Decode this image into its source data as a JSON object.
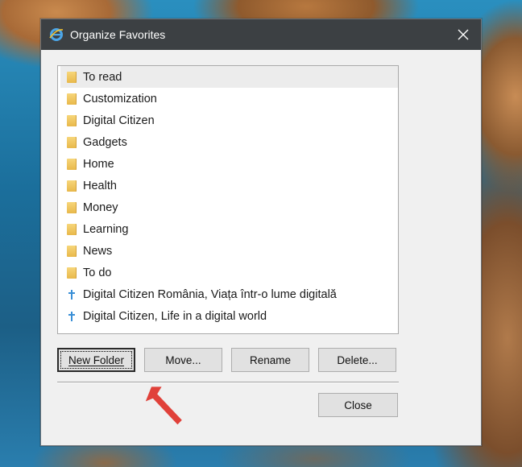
{
  "window": {
    "title": "Organize Favorites",
    "icon": "ie-icon",
    "close_icon": "close-icon"
  },
  "list": {
    "items": [
      {
        "label": "To read",
        "icon": "folder-icon",
        "selected": true
      },
      {
        "label": "Customization",
        "icon": "folder-icon"
      },
      {
        "label": "Digital Citizen",
        "icon": "folder-icon"
      },
      {
        "label": "Gadgets",
        "icon": "folder-icon"
      },
      {
        "label": "Home",
        "icon": "folder-icon"
      },
      {
        "label": "Health",
        "icon": "folder-icon"
      },
      {
        "label": "Money",
        "icon": "folder-icon"
      },
      {
        "label": "Learning",
        "icon": "folder-icon"
      },
      {
        "label": "News",
        "icon": "folder-icon"
      },
      {
        "label": "To do",
        "icon": "folder-icon"
      },
      {
        "label": "Digital Citizen România, Viața într-o lume digitală",
        "icon": "pinned-site-icon"
      },
      {
        "label": "Digital Citizen, Life in a digital world",
        "icon": "pinned-site-icon"
      }
    ]
  },
  "buttons": {
    "new_folder": "New Folder",
    "move": "Move...",
    "rename": "Rename",
    "delete": "Delete...",
    "close": "Close"
  },
  "colors": {
    "titlebar": "#3c4043",
    "annotation_arrow": "#e0413a",
    "folder": "#e8b84a",
    "pinned_site": "#3a8fd6"
  }
}
